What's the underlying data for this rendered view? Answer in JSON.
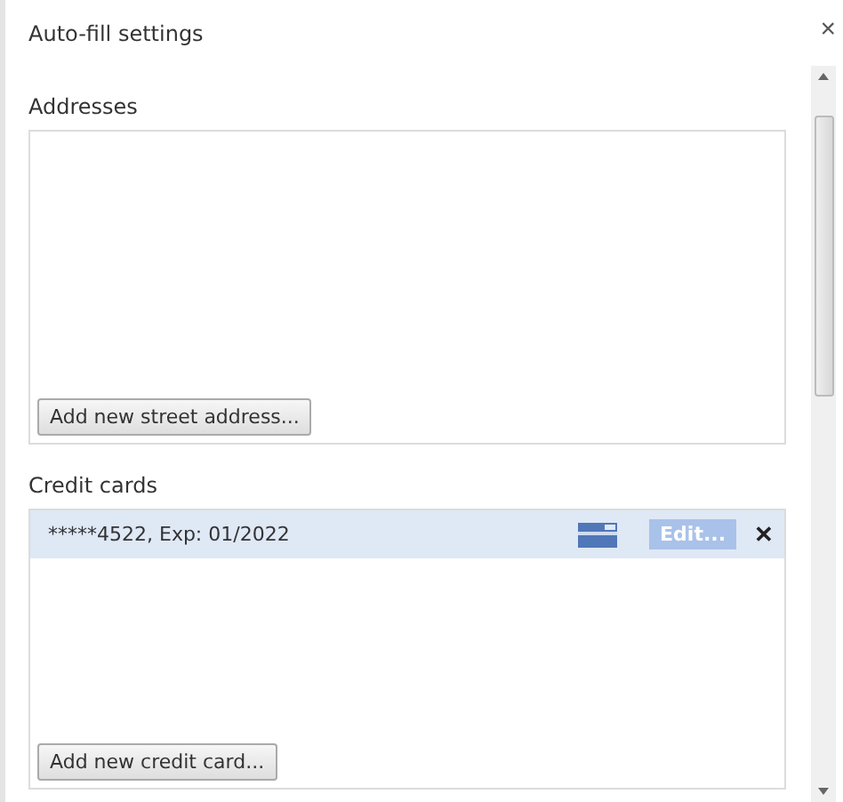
{
  "dialog": {
    "title": "Auto-fill settings",
    "close": "×"
  },
  "addresses": {
    "heading": "Addresses",
    "add_button": "Add new street address..."
  },
  "credit_cards": {
    "heading": "Credit cards",
    "items": [
      {
        "label": "*****4522, Exp: 01/2022",
        "selected": true,
        "edit": {
          "label": "Edit...",
          "disabled": true
        },
        "remove": "✕"
      }
    ],
    "add_button": "Add new credit card..."
  }
}
